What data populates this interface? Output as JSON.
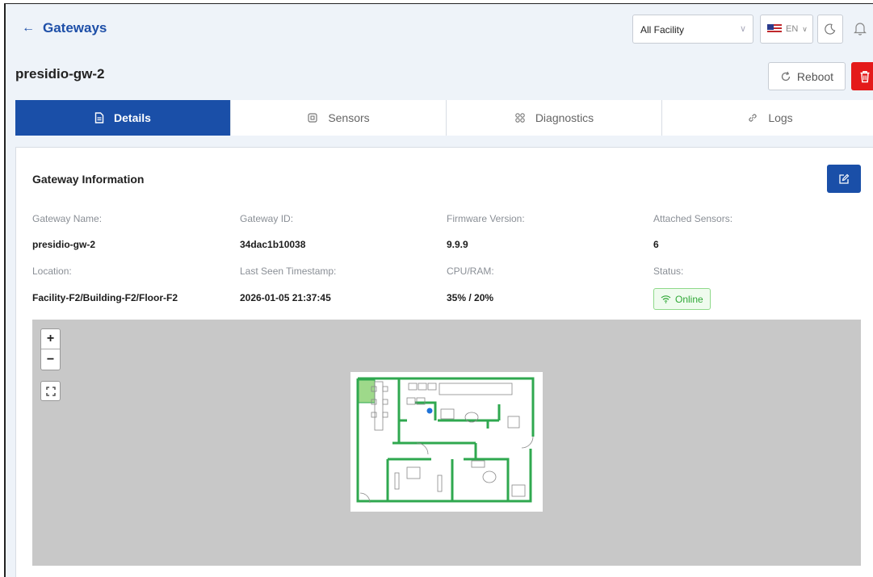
{
  "header": {
    "back_label": "Gateways",
    "facility_select": "All Facility",
    "language": "EN"
  },
  "title": "presidio-gw-2",
  "actions": {
    "reboot_label": "Reboot"
  },
  "tabs": [
    {
      "label": "Details",
      "icon": "document-icon",
      "active": true
    },
    {
      "label": "Sensors",
      "icon": "chip-icon",
      "active": false
    },
    {
      "label": "Diagnostics",
      "icon": "diagnostics-icon",
      "active": false
    },
    {
      "label": "Logs",
      "icon": "link-icon",
      "active": false
    }
  ],
  "card": {
    "title": "Gateway Information",
    "fields": {
      "gateway_name": {
        "label": "Gateway Name:",
        "value": "presidio-gw-2"
      },
      "gateway_id": {
        "label": "Gateway ID:",
        "value": "34dac1b10038"
      },
      "firmware": {
        "label": "Firmware Version:",
        "value": "9.9.9"
      },
      "sensors": {
        "label": "Attached Sensors:",
        "value": "6"
      },
      "location": {
        "label": "Location:",
        "value": "Facility-F2/Building-F2/Floor-F2"
      },
      "last_seen": {
        "label": "Last Seen Timestamp:",
        "value": "2026-01-05 21:37:45"
      },
      "cpu_ram": {
        "label": "CPU/RAM:",
        "value": "35% / 20%"
      },
      "status": {
        "label": "Status:",
        "value": "Online"
      }
    }
  },
  "map": {
    "zoom_in": "+",
    "zoom_out": "−"
  },
  "colors": {
    "primary": "#1a4fa8",
    "danger": "#e41a1a",
    "online": "#2fa836",
    "wall": "#2fa84f"
  }
}
